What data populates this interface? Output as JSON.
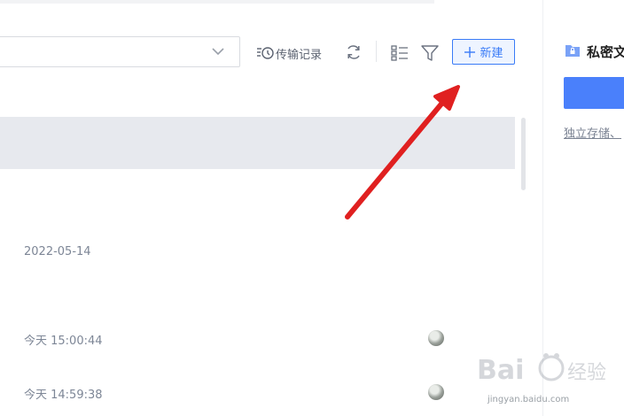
{
  "toolbar": {
    "transfer_label": "传输记录",
    "new_label": "新建",
    "icons": [
      "history-icon",
      "refresh-icon",
      "list-view-icon",
      "filter-icon",
      "plus-icon",
      "chevron-down-icon"
    ]
  },
  "file_list": {
    "rows": [
      {
        "date": "2022-05-14"
      },
      {
        "date": "今天 15:00:44"
      },
      {
        "date": "今天 14:59:38"
      }
    ]
  },
  "side_panel": {
    "title": "私密文",
    "link": "独立存储、"
  },
  "watermark": {
    "text": "jingyan.baidu.com"
  },
  "colors": {
    "accent": "#3a7bf7",
    "arrow": "#e02020",
    "selected_row": "#e7e9ee"
  }
}
